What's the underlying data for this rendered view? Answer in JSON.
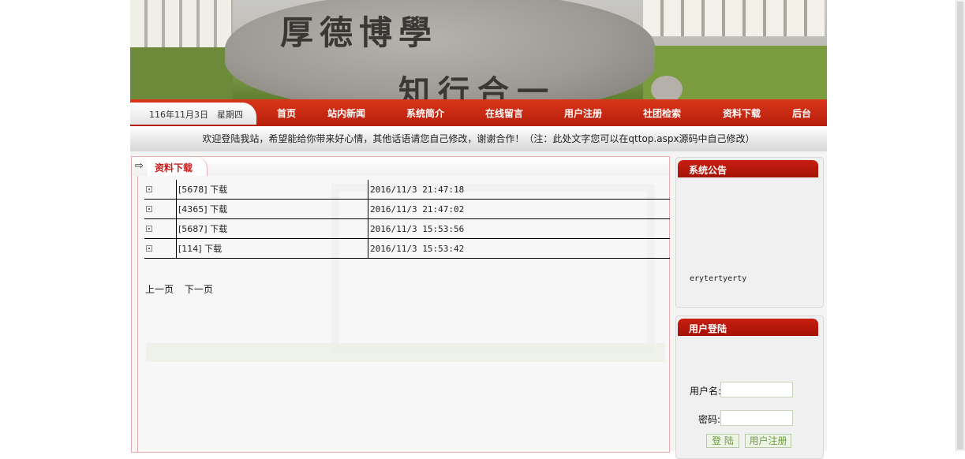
{
  "banner": {
    "line1": "厚德博學",
    "line2": "知行合一"
  },
  "date_text": "116年11月3日　星期四",
  "nav": {
    "items": [
      "首页",
      "站内新闻",
      "系统简介",
      "在线留言",
      "用户注册",
      "社团检索",
      "资料下载",
      "后台"
    ]
  },
  "welcome_text": "欢迎登陆我站，希望能给你带来好心情，其他话语请您自己修改，谢谢合作！（注：此处文字您可以在qttop.aspx源码中自己修改）",
  "main": {
    "section_title": "资料下载",
    "rows": [
      {
        "name": "[5678] 下载",
        "date": "2016/11/3 21:47:18"
      },
      {
        "name": "[4365] 下载",
        "date": "2016/11/3 21:47:02"
      },
      {
        "name": "[5687] 下载",
        "date": "2016/11/3 15:53:56"
      },
      {
        "name": "[114] 下载",
        "date": "2016/11/3 15:53:42"
      }
    ],
    "pager": {
      "prev": "上一页",
      "next": "下一页"
    }
  },
  "sidebar": {
    "notice_title": "系统公告",
    "notice_text": "erytertyerty",
    "login_title": "用户登陆",
    "username_label": "用户名:",
    "password_label": "密码:",
    "login_button": "登 陆",
    "register_button": "用户注册"
  }
}
